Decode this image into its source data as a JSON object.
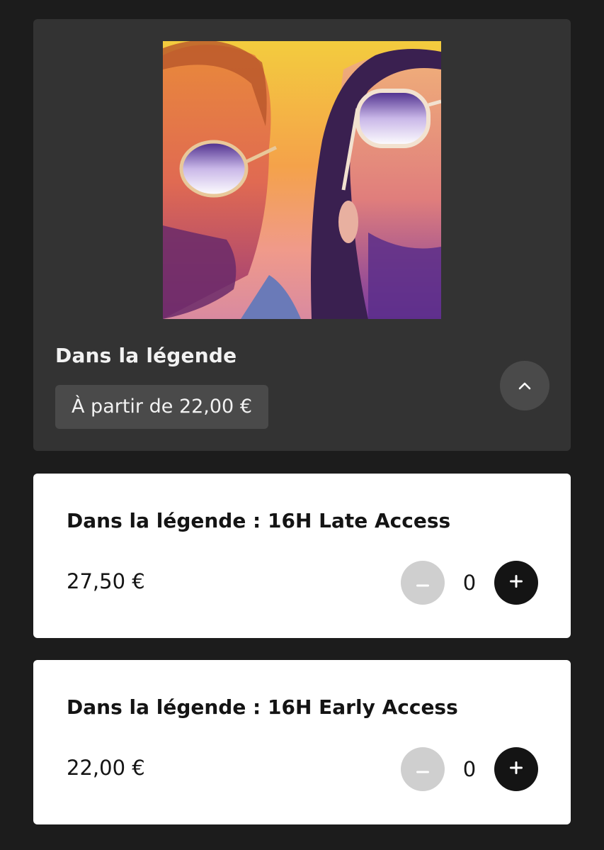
{
  "product": {
    "cover_icon": "album-cover-two-men-sunglasses",
    "title": "Dans la légende",
    "price_from": "À partir de 22,00 €",
    "collapse_icon": "chevron-up-icon"
  },
  "tickets": [
    {
      "name": "Dans la légende : 16H Late Access",
      "price": "27,50 €",
      "quantity": "0",
      "minus_icon": "minus-icon",
      "plus_icon": "plus-icon"
    },
    {
      "name": "Dans la légende : 16H Early Access",
      "price": "22,00 €",
      "quantity": "0",
      "minus_icon": "minus-icon",
      "plus_icon": "plus-icon"
    }
  ],
  "colors": {
    "page_background": "#1c1c1c",
    "card_background": "#333333",
    "chip_background": "#4a4a4a",
    "ticket_background": "#ffffff",
    "button_dark": "#141414",
    "button_disabled": "#cfcfcf"
  }
}
